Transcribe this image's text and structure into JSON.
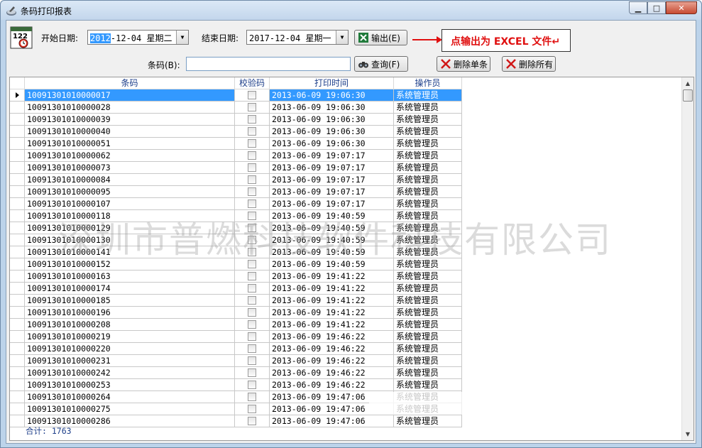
{
  "window": {
    "title": "条码打印报表",
    "buttons": {
      "minimize": "▁",
      "maximize": "□",
      "close": "✕"
    }
  },
  "toolbar": {
    "start_label": "开始日期:",
    "start_value_selected": "2012",
    "start_value_rest": "-12-04 星期二",
    "end_label": "结束日期:",
    "end_value": "2017-12-04 星期一",
    "export_button": "输出(E)",
    "callout_text": "点输出为 EXCEL 文件↵",
    "barcode_label": "条码(B):",
    "barcode_value": "",
    "query_button": "查询(F)",
    "delete_one_button": "删除单条",
    "delete_all_button": "删除所有"
  },
  "grid": {
    "columns": [
      "条码",
      "校验码",
      "打印时间",
      "操作员"
    ],
    "rows": [
      [
        "10091301010000017",
        "2013-06-09 19:06:30",
        "系统管理员"
      ],
      [
        "10091301010000028",
        "2013-06-09 19:06:30",
        "系统管理员"
      ],
      [
        "10091301010000039",
        "2013-06-09 19:06:30",
        "系统管理员"
      ],
      [
        "10091301010000040",
        "2013-06-09 19:06:30",
        "系统管理员"
      ],
      [
        "10091301010000051",
        "2013-06-09 19:06:30",
        "系统管理员"
      ],
      [
        "10091301010000062",
        "2013-06-09 19:07:17",
        "系统管理员"
      ],
      [
        "10091301010000073",
        "2013-06-09 19:07:17",
        "系统管理员"
      ],
      [
        "10091301010000084",
        "2013-06-09 19:07:17",
        "系统管理员"
      ],
      [
        "10091301010000095",
        "2013-06-09 19:07:17",
        "系统管理员"
      ],
      [
        "10091301010000107",
        "2013-06-09 19:07:17",
        "系统管理员"
      ],
      [
        "10091301010000118",
        "2013-06-09 19:40:59",
        "系统管理员"
      ],
      [
        "10091301010000129",
        "2013-06-09 19:40:59",
        "系统管理员"
      ],
      [
        "10091301010000130",
        "2013-06-09 19:40:59",
        "系统管理员"
      ],
      [
        "10091301010000141",
        "2013-06-09 19:40:59",
        "系统管理员"
      ],
      [
        "10091301010000152",
        "2013-06-09 19:40:59",
        "系统管理员"
      ],
      [
        "10091301010000163",
        "2013-06-09 19:41:22",
        "系统管理员"
      ],
      [
        "10091301010000174",
        "2013-06-09 19:41:22",
        "系统管理员"
      ],
      [
        "10091301010000185",
        "2013-06-09 19:41:22",
        "系统管理员"
      ],
      [
        "10091301010000196",
        "2013-06-09 19:41:22",
        "系统管理员"
      ],
      [
        "10091301010000208",
        "2013-06-09 19:41:22",
        "系统管理员"
      ],
      [
        "10091301010000219",
        "2013-06-09 19:46:22",
        "系统管理员"
      ],
      [
        "10091301010000220",
        "2013-06-09 19:46:22",
        "系统管理员"
      ],
      [
        "10091301010000231",
        "2013-06-09 19:46:22",
        "系统管理员"
      ],
      [
        "10091301010000242",
        "2013-06-09 19:46:22",
        "系统管理员"
      ],
      [
        "10091301010000253",
        "2013-06-09 19:46:22",
        "系统管理员"
      ],
      [
        "10091301010000264",
        "2013-06-09 19:47:06",
        "系统管理员"
      ],
      [
        "10091301010000275",
        "2013-06-09 19:47:06",
        "系统管理员"
      ],
      [
        "10091301010000286",
        "2013-06-09 19:47:06",
        "系统管理员"
      ]
    ],
    "footer": "合计: 1763"
  },
  "watermark": "深圳市普燃科技软件科技有限公司",
  "colors": {
    "selection": "#3399ff",
    "callout": "#e01010",
    "header_text": "#1e3f8a"
  }
}
